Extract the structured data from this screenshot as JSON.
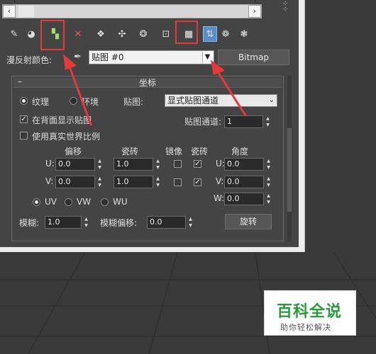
{
  "toolbar": {
    "icons": [
      "teapot-get-material-icon",
      "put-to-scene-icon",
      "assign-to-selection-icon",
      "reset-delete-icon",
      "make-copy-icon",
      "make-unique-icon",
      "put-to-library-icon",
      "material-id-channel-icon",
      "show-map-in-viewport-icon",
      "show-end-result-icon",
      "go-to-parent-icon",
      "go-forward-sibling-icon"
    ]
  },
  "diffuse": {
    "label": "漫反射颜色:",
    "map_name": "贴图 #0",
    "map_type_button": "Bitmap"
  },
  "coordinates": {
    "title": "坐标",
    "collapse": "–",
    "texture_label": "纹理",
    "environ_label": "环境",
    "mapping_label": "贴图:",
    "mapping_value": "显式贴图通道",
    "show_map_on_back_label": "在背面显示贴图",
    "show_map_on_back_checked": true,
    "real_world_label": "使用真实世界比例",
    "real_world_checked": false,
    "map_channel_label": "贴图通道:",
    "map_channel_value": "1",
    "header_offset": "偏移",
    "header_tiling": "瓷砖",
    "header_mirror": "镜像",
    "header_tile": "瓷砖",
    "header_angle": "角度",
    "u_label": "U:",
    "v_label": "V:",
    "w_label": "W:",
    "u_offset": "0.0",
    "v_offset": "0.0",
    "u_tiling": "1.0",
    "v_tiling": "1.0",
    "u_mirror": false,
    "v_mirror": false,
    "u_tile": true,
    "v_tile": true,
    "u_angle": "0.0",
    "v_angle": "0.0",
    "w_angle": "0.0",
    "uv_label": "UV",
    "vw_label": "VW",
    "wu_label": "WU",
    "blur_label": "模糊:",
    "blur_value": "1.0",
    "blur_offset_label": "模糊偏移:",
    "blur_offset_value": "0.0",
    "rotate_button": "旋转"
  },
  "watermark": {
    "title": "百科全说",
    "subtitle": "助你轻松解决"
  },
  "colors": {
    "highlight": "#e23a3a",
    "panel": "#444444",
    "watermark_green": "#2a9b3c"
  }
}
